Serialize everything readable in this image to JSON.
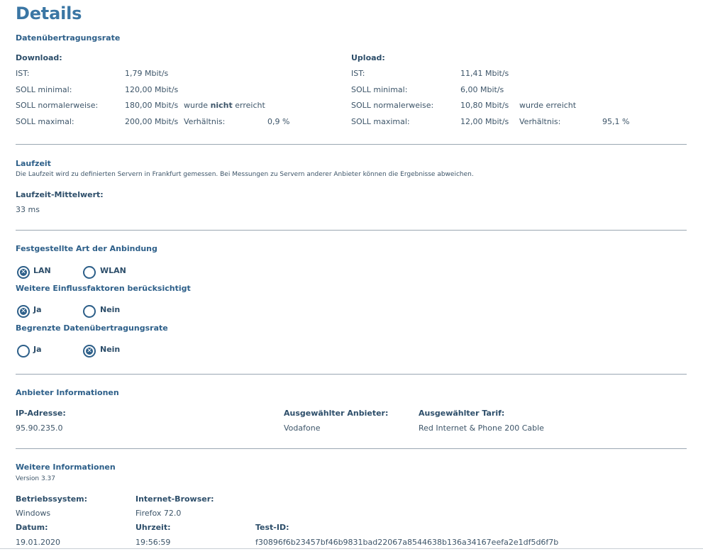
{
  "title": "Details",
  "rate": {
    "heading": "Datenübertragungsrate",
    "download": {
      "title": "Download:",
      "ist_label": "IST:",
      "ist_value": "1,79 Mbit/s",
      "min_label": "SOLL minimal:",
      "min_value": "120,00 Mbit/s",
      "normal_label": "SOLL normalerweise:",
      "normal_value": "180,00 Mbit/s",
      "status_prefix": "wurde",
      "status_emph": "nicht",
      "status_suffix": "erreicht",
      "max_label": "SOLL maximal:",
      "max_value": "200,00 Mbit/s",
      "ratio_label": "Verhältnis:",
      "ratio_value": "0,9 %"
    },
    "upload": {
      "title": "Upload:",
      "ist_label": "IST:",
      "ist_value": "11,41 Mbit/s",
      "min_label": "SOLL minimal:",
      "min_value": "6,00 Mbit/s",
      "normal_label": "SOLL normalerweise:",
      "normal_value": "10,80 Mbit/s",
      "status": "wurde erreicht",
      "max_label": "SOLL maximal:",
      "max_value": "12,00 Mbit/s",
      "ratio_label": "Verhältnis:",
      "ratio_value": "95,1 %"
    }
  },
  "latency": {
    "heading": "Laufzeit",
    "note": "Die Laufzeit wird zu definierten Servern in Frankfurt gemessen. Bei Messungen zu Servern anderer Anbieter können die Ergebnisse abweichen.",
    "mean_label": "Laufzeit-Mittelwert:",
    "mean_value": "33 ms"
  },
  "connection": {
    "heading": "Festgestellte Art der Anbindung",
    "options": [
      {
        "label": "LAN",
        "checked": true
      },
      {
        "label": "WLAN",
        "checked": false
      }
    ]
  },
  "factors": {
    "heading": "Weitere Einflussfaktoren berücksichtigt",
    "options": [
      {
        "label": "Ja",
        "checked": true
      },
      {
        "label": "Nein",
        "checked": false
      }
    ]
  },
  "limited": {
    "heading": "Begrenzte Datenübertragungsrate",
    "options": [
      {
        "label": "Ja",
        "checked": false
      },
      {
        "label": "Nein",
        "checked": true
      }
    ]
  },
  "provider": {
    "heading": "Anbieter Informationen",
    "ip_label": "IP-Adresse:",
    "ip_value": "95.90.235.0",
    "provider_label": "Ausgewählter Anbieter:",
    "provider_value": "Vodafone",
    "tariff_label": "Ausgewählter Tarif:",
    "tariff_value": "Red Internet & Phone 200 Cable"
  },
  "more": {
    "heading": "Weitere Informationen",
    "version": "Version 3.37",
    "os_label": "Betriebssystem:",
    "os_value": "Windows",
    "browser_label": "Internet-Browser:",
    "browser_value": "Firefox 72.0",
    "date_label": "Datum:",
    "date_value": "19.01.2020",
    "time_label": "Uhrzeit:",
    "time_value": "19:56:59",
    "testid_label": "Test-ID:",
    "testid_value": "f30896f6b23457bf46b9831bad22067a8544638b136a34167eefa2e1df5d6f7b"
  },
  "colors": {
    "accent": "#3a76a4",
    "heading": "#2d5f89",
    "text": "#3d5569",
    "rule": "#9aa7b2"
  }
}
